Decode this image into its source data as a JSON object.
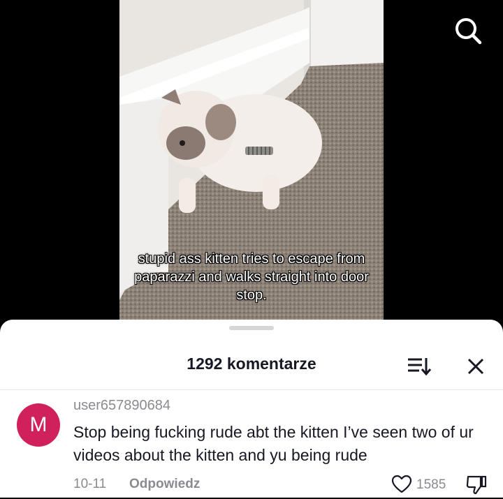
{
  "video": {
    "caption": "stupid ass kitten tries to escape from paparazzi and walks straight into door stop."
  },
  "icons": {
    "search": "search-icon",
    "sort": "sort-icon",
    "close": "close-icon",
    "like": "heart-icon",
    "dislike": "thumbs-down-icon"
  },
  "comments_panel": {
    "title": "1292 komentarze"
  },
  "comment": {
    "avatar_letter": "M",
    "avatar_color": "#d1215c",
    "username": "user657890684",
    "text": "Stop being fucking rude abt the kitten I’ve seen two of ur videos about the kitten and yu being rude",
    "date": "10-11",
    "reply_label": "Odpowiedz",
    "like_count": "1585"
  }
}
